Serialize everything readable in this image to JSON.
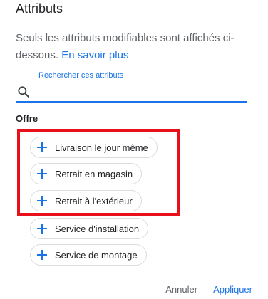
{
  "dialog": {
    "title": "Attributs",
    "description": "Seuls les attributs modifiables sont affichés ci-dessous.",
    "learn_more": "En savoir plus"
  },
  "search": {
    "label": "Rechercher ces attributs",
    "value": "",
    "icon": "search-icon"
  },
  "section": {
    "title": "Offre",
    "chips": [
      {
        "label": "Livraison le jour même",
        "icon": "plus-icon",
        "highlighted": true
      },
      {
        "label": "Retrait en magasin",
        "icon": "plus-icon",
        "highlighted": true
      },
      {
        "label": "Retrait à l'extérieur",
        "icon": "plus-icon",
        "highlighted": true
      },
      {
        "label": "Service d'installation",
        "icon": "plus-icon",
        "highlighted": false
      },
      {
        "label": "Service de montage",
        "icon": "plus-icon",
        "highlighted": false
      }
    ]
  },
  "footer": {
    "cancel_label": "Annuler",
    "apply_label": "Appliquer"
  },
  "colors": {
    "accent": "#1a73e8",
    "highlight": "#e8101a",
    "text": "#202124",
    "muted": "#5f6368",
    "chip_border": "#dadce0"
  }
}
